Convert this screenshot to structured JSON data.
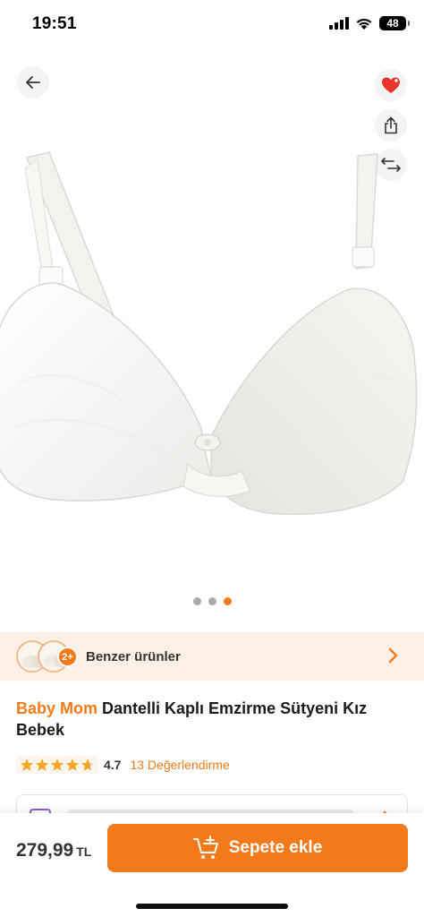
{
  "status_bar": {
    "time": "19:51",
    "battery": "48"
  },
  "product": {
    "brand": "Baby Mom",
    "name": "Dantelli Kaplı Emzirme Sütyeni Kız Bebek",
    "rating": "4.7",
    "rating_stars": 4.7,
    "review_count": "13 Değerlendirme",
    "price": "279,99",
    "currency": "TL"
  },
  "gallery": {
    "image_count": 3,
    "active_index": 2
  },
  "similar": {
    "badge": "2+",
    "label": "Benzer ürünler"
  },
  "actions": {
    "add_to_cart": "Sepete ekle"
  },
  "icons": {
    "back": "arrow-left-icon",
    "favorite": "heart-icon",
    "share": "share-icon",
    "compare": "compare-arrows-icon",
    "cart": "cart-plus-icon",
    "chevron": "chevron-right-icon"
  },
  "colors": {
    "accent": "#f27a1a",
    "favorite": "#e8362b",
    "similar_bg": "#fdf1e7"
  }
}
